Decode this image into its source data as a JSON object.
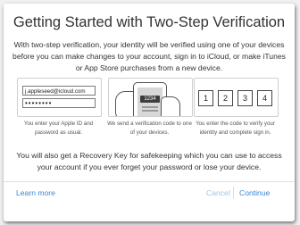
{
  "dialog": {
    "title": "Getting Started with Two-Step Verification",
    "intro": "With two-step verification, your identity will be verified using one of your devices before you can make changes to your account, sign in to iCloud, or make iTunes or App Store purchases from a new device.",
    "steps": [
      {
        "email_value": "j.appleseed@icloud.com",
        "password_value": "••••••••",
        "caption": "You enter your Apple ID and password as usual."
      },
      {
        "code": "1234",
        "caption": "We send a verification code to one of your devices."
      },
      {
        "digits": [
          "1",
          "2",
          "3",
          "4"
        ],
        "caption": "You enter the code to verify your identity and complete sign in."
      }
    ],
    "recovery": "You will also get a Recovery Key for safekeeping which you can use to access your account if you ever forget your password or lose your device.",
    "footer": {
      "learn_more": "Learn more",
      "cancel": "Cancel",
      "continue": "Continue"
    }
  },
  "colors": {
    "link": "#3a87d6",
    "link_disabled": "#9fc3e8"
  }
}
